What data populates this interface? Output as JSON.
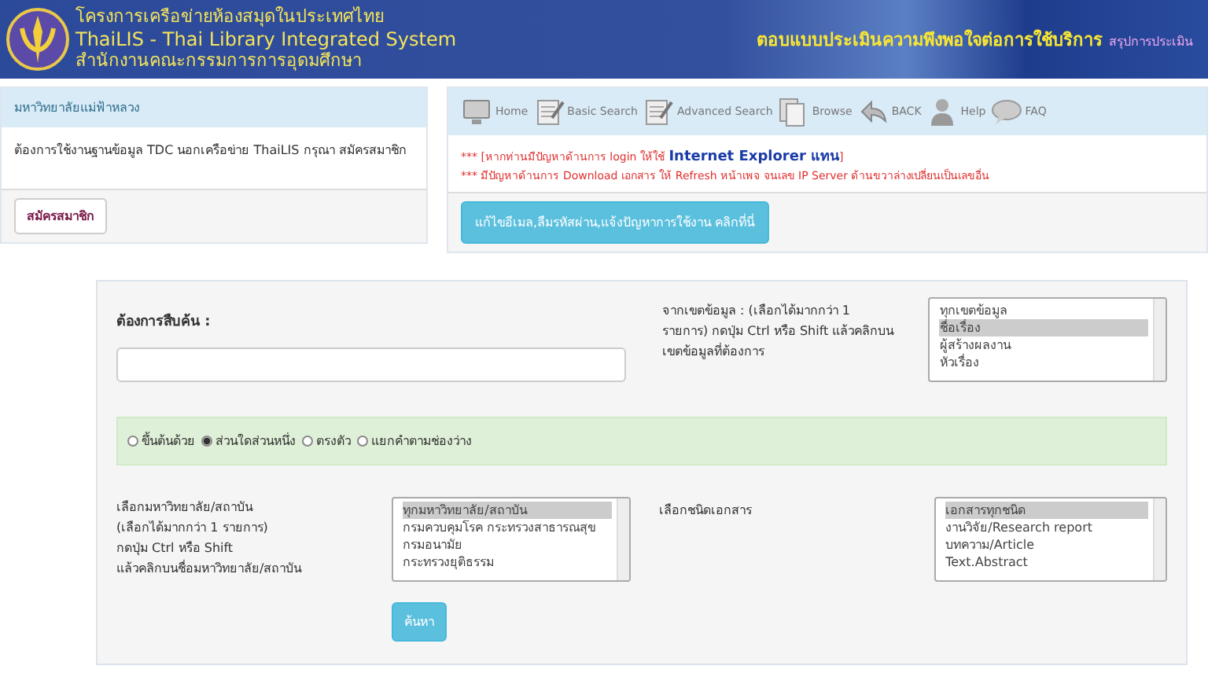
{
  "header": {
    "title_th": "โครงการเครือข่ายห้องสมุดในประเทศไทย",
    "title_en": "ThaiLIS - Thai Library Integrated System",
    "subtitle": "สำนักงานคณะกรรมการการอุดมศึกษา",
    "survey_link": "ตอบแบบประเมินความพึงพอใจต่อการใช้บริการ",
    "summary_link": "สรุปการประเมิน"
  },
  "member_panel": {
    "heading": "มหาวิทยาลัยแม่ฟ้าหลวง",
    "message": "ต้องการใช้งานฐานข้อมูล TDC นอกเครือข่าย ThaiLIS กรุณา สมัครสมาชิก",
    "button": "สมัครสมาชิก"
  },
  "nav": [
    {
      "kind": "monitor",
      "label": "Home"
    },
    {
      "kind": "notepad",
      "label": "Basic Search"
    },
    {
      "kind": "notepad",
      "label": "Advanced Search"
    },
    {
      "kind": "documents",
      "label": "Browse"
    },
    {
      "kind": "back",
      "label": "BACK"
    },
    {
      "kind": "person",
      "label": "Help"
    },
    {
      "kind": "bubble",
      "label": "FAQ"
    }
  ],
  "notices": [
    [
      {
        "text": "*** [หากท่านมีปัญหาด้านการ login ให้ใช้ ",
        "emphasis": false
      },
      {
        "text": "Internet Explorer แทน",
        "emphasis": true
      },
      {
        "text": "]",
        "emphasis": false
      }
    ],
    [
      {
        "text": "*** มีปัญหาด้านการ Download เอกสาร ให้ Refresh หน้าเพจ จนเลข IP Server ด้านขวาล่างเปลี่ยนเป็นเลขอื่น",
        "emphasis": false
      }
    ]
  ],
  "help_button": "แก้ไขอีเมล,ลืมรหัสผ่าน,แจ้งปัญหาการใช้งาน คลิกที่นี่",
  "search": {
    "query_label": "ต้องการสืบค้น :",
    "field_label": "จากเขตข้อมูล : (เลือกได้มากกว่า 1 รายการ) กดปุ่ม Ctrl หรือ Shift แล้วคลิกบนเขตข้อมูลที่ต้องการ",
    "fields": [
      {
        "label": "ทุกเขตข้อมูล",
        "selected": false
      },
      {
        "label": "ชื่อเรื่อง",
        "selected": true
      },
      {
        "label": "ผู้สร้างผลงาน",
        "selected": false
      },
      {
        "label": "หัวเรื่อง",
        "selected": false
      }
    ],
    "match_modes": [
      {
        "label": "ขึ้นต้นด้วย",
        "selected": false
      },
      {
        "label": "ส่วนใดส่วนหนึ่ง",
        "selected": true
      },
      {
        "label": "ตรงตัว",
        "selected": false
      },
      {
        "label": "แยกคำตามช่องว่าง",
        "selected": false
      }
    ],
    "institution_label": [
      "เลือกมหาวิทยาลัย/สถาบัน",
      "(เลือกได้มากกว่า 1 รายการ)",
      "กดปุ่ม Ctrl หรือ Shift",
      "แล้วคลิกบนชื่อมหาวิทยาลัย/สถาบัน"
    ],
    "institutions": [
      {
        "label": "ทุกมหาวิทยาลัย/สถาบัน",
        "selected": true
      },
      {
        "label": "กรมควบคุมโรค กระทรวงสาธารณสุข",
        "selected": false
      },
      {
        "label": "กรมอนามัย",
        "selected": false
      },
      {
        "label": "กระทรวงยุติธรรม",
        "selected": false
      }
    ],
    "doctype_label": "เลือกชนิดเอกสาร",
    "doctypes": [
      {
        "label": "เอกสารทุกชนิด",
        "selected": true
      },
      {
        "label": "งานวิจัย/Research report",
        "selected": false
      },
      {
        "label": "บทความ/Article",
        "selected": false
      },
      {
        "label": "Text.Abstract",
        "selected": false
      }
    ],
    "submit": "ค้นหา"
  }
}
